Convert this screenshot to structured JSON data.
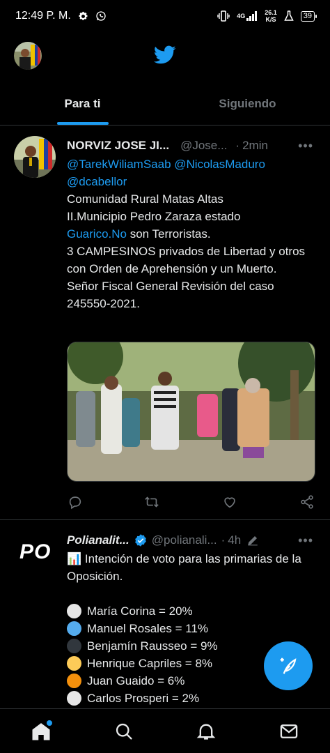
{
  "status_bar": {
    "time": "12:49 P. M.",
    "network": "4G",
    "speed_value": "26.1",
    "speed_unit": "K/S",
    "battery": "39"
  },
  "tabs": [
    {
      "label": "Para ti",
      "active": true
    },
    {
      "label": "Siguiendo",
      "active": false
    }
  ],
  "tweet1": {
    "name": "NORVIZ JOSE JI...",
    "handle": "@Jose...",
    "dot": "·",
    "time": "2min",
    "mentions": [
      "@TarekWiliamSaab",
      "@NicolasMaduro",
      "@dcabellor"
    ],
    "lines": [
      "Comunidad Rural  Matas Altas",
      "II.Municipio Pedro Zaraza estado"
    ],
    "link_text": "Guarico.No",
    "after_link": " son Terroristas.",
    "lines2": [
      "3 CAMPESINOS privados de Libertad  y otros con Orden de Aprehensión y un Muerto.",
      "Señor Fiscal General Revisión del caso 245550-2021."
    ]
  },
  "tweet2": {
    "avatar_text": "PO",
    "name": "Polianalit...",
    "handle": "@polianali...",
    "dot": "·",
    "time": "4h",
    "headline_emoji": "📊",
    "headline": " Intención de voto para las primarias de la Oposición.",
    "items": [
      {
        "text": "María Corina = 20%",
        "color": "#e6e6e6"
      },
      {
        "text": "Manuel Rosales = 11%",
        "color": "#55acee"
      },
      {
        "text": "Benjamín Rausseo = 9%",
        "color": "#31373d"
      },
      {
        "text": "Henrique Capriles = 8%",
        "color": "#fdcb58"
      },
      {
        "text": "Juan Guaido = 6%",
        "color": "#f4900c"
      },
      {
        "text": "Carlos Prosperi = 2%",
        "color": "#e6e6e6"
      }
    ]
  },
  "colors": {
    "accent": "#1d9bf0",
    "text": "#e7e9ea",
    "muted": "#71767b",
    "border": "#2f3336",
    "background": "#000000"
  },
  "nav": [
    "home-icon",
    "search-icon",
    "notifications-icon",
    "messages-icon"
  ]
}
